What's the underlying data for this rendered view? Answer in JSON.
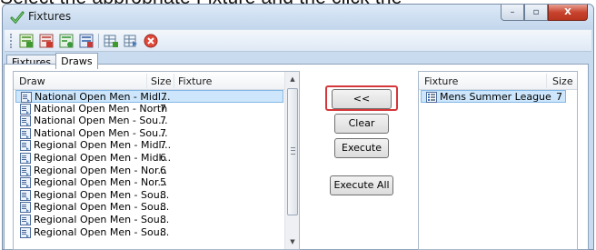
{
  "caption": "Select the appropriate Fixture and the click the",
  "window": {
    "title": "Fixtures",
    "controls": {
      "minimize": "–",
      "maximize": "▫",
      "close": "X"
    }
  },
  "toolbar": {
    "icons": [
      "green-add-icon",
      "red-remove-icon",
      "green-edit-icon",
      "blue-copy-icon",
      "grid-add-icon",
      "grid-export-icon",
      "stop-icon"
    ]
  },
  "tabs": [
    {
      "label": "Fixtures",
      "active": false
    },
    {
      "label": "Draws",
      "active": true
    }
  ],
  "draws_grid": {
    "columns": {
      "draw": "Draw",
      "size": "Size",
      "fixture": "Fixture"
    },
    "rows": [
      {
        "draw": "National Open Men - Midl...",
        "size": "7",
        "selected": true
      },
      {
        "draw": "National Open Men - North",
        "size": "7"
      },
      {
        "draw": "National Open Men - Sou...",
        "size": "7"
      },
      {
        "draw": "National Open Men - Sou...",
        "size": "7"
      },
      {
        "draw": "Regional Open Men - Midl...",
        "size": "7"
      },
      {
        "draw": "Regional Open Men - Midl...",
        "size": "6"
      },
      {
        "draw": "Regional Open Men - Nor...",
        "size": "6"
      },
      {
        "draw": "Regional Open Men - Nor...",
        "size": "5"
      },
      {
        "draw": "Regional Open Men - Sou...",
        "size": "8"
      },
      {
        "draw": "Regional Open Men - Sou...",
        "size": "8"
      },
      {
        "draw": "Regional Open Men - Sou...",
        "size": "8"
      },
      {
        "draw": "Regional Open Men - Sou...",
        "size": "8"
      }
    ]
  },
  "actions": {
    "assign": "<<",
    "clear": "Clear",
    "execute": "Execute",
    "execute_all": "Execute All"
  },
  "fixtures_grid": {
    "columns": {
      "fixture": "Fixture",
      "size": "Size"
    },
    "rows": [
      {
        "fixture": "Mens Summer League",
        "size": "7",
        "selected": true
      }
    ]
  },
  "colors": {
    "highlight_outline": "#d4373a",
    "selection": "#cde6fb",
    "window_frame": "#c9dbee"
  }
}
